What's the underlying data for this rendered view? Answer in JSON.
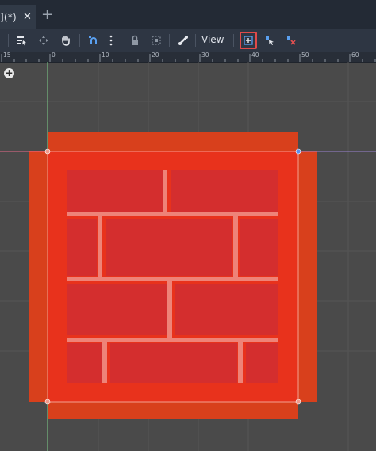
{
  "tab": {
    "title": "](*)",
    "close_glyph": "✕",
    "add_glyph": "+"
  },
  "toolbar": {
    "view_label": "View",
    "icons": [
      "select-list-icon",
      "move-icon",
      "pan-hand-icon",
      "snap-icon",
      "more-vert-icon",
      "lock-icon",
      "group-icon",
      "bone-icon",
      "anchor-add-icon",
      "node-cursor-icon",
      "node-remove-icon"
    ]
  },
  "ruler": {
    "labels": [
      "15",
      "0",
      "10",
      "20",
      "30",
      "40",
      "50",
      "60"
    ]
  },
  "viewport": {
    "add_glyph": "+"
  },
  "colors": {
    "canvas_bg": "#4a4a4a",
    "grid": "#555555",
    "outer_region": "#d8401c",
    "brick_fill": "#e03a20",
    "mortar": "#f08a7a",
    "handle": "#f0a090",
    "handle_alt": "#5a8ff0"
  }
}
